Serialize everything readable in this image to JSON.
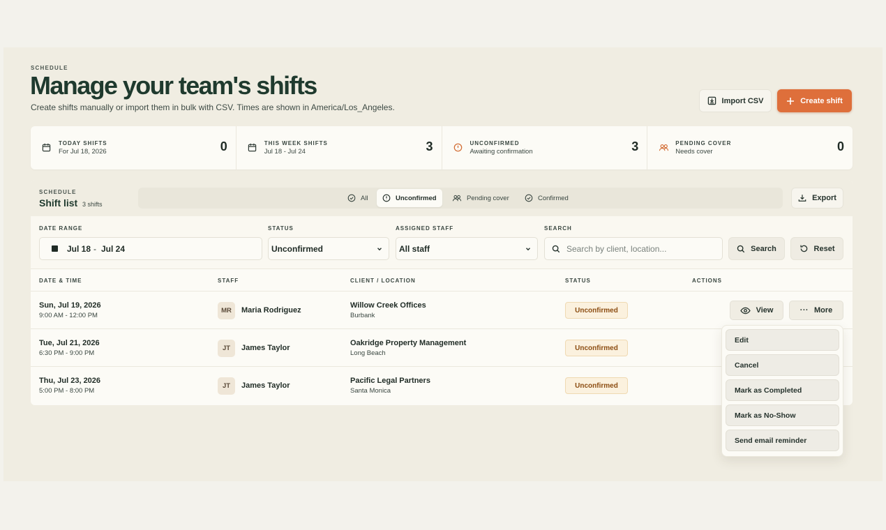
{
  "header": {
    "eyebrow": "SCHEDULE",
    "title": "Manage your team's shifts",
    "subtitle": "Create shifts manually or import them in bulk with CSV. Times are shown in America/Los_Angeles.",
    "import_label": "Import CSV",
    "create_label": "Create shift"
  },
  "stats": [
    {
      "label": "TODAY SHIFTS",
      "sub": "For Jul 18, 2026",
      "value": "0",
      "icon": "calendar-icon"
    },
    {
      "label": "THIS WEEK SHIFTS",
      "sub": "Jul 18 - Jul 24",
      "value": "3",
      "icon": "calendar-icon"
    },
    {
      "label": "UNCONFIRMED",
      "sub": "Awaiting confirmation",
      "value": "3",
      "icon": "alert-circle-icon"
    },
    {
      "label": "PENDING COVER",
      "sub": "Needs cover",
      "value": "0",
      "icon": "users-icon"
    }
  ],
  "list": {
    "eyebrow": "SCHEDULE",
    "title": "Shift list",
    "count": "3 shifts",
    "tabs": [
      {
        "label": "All",
        "active": false
      },
      {
        "label": "Unconfirmed",
        "active": true
      },
      {
        "label": "Pending cover",
        "active": false
      },
      {
        "label": "Confirmed",
        "active": false
      }
    ],
    "export_label": "Export"
  },
  "filters": {
    "date_range_label": "DATE RANGE",
    "date_from": "Jul 18",
    "date_sep": "-",
    "date_to": "Jul 24",
    "status_label": "STATUS",
    "status_value": "Unconfirmed",
    "staff_label": "ASSIGNED STAFF",
    "staff_value": "All staff",
    "search_label": "SEARCH",
    "search_placeholder": "Search by client, location...",
    "search_button": "Search",
    "reset_button": "Reset"
  },
  "table": {
    "columns": [
      "DATE & TIME",
      "STAFF",
      "CLIENT / LOCATION",
      "STATUS",
      "ACTIONS"
    ],
    "rows": [
      {
        "date": "Sun, Jul 19, 2026",
        "time": "9:00 AM - 12:00 PM",
        "initials": "MR",
        "staff": "Maria Rodriguez",
        "client": "Willow Creek Offices",
        "location": "Burbank",
        "status": "Unconfirmed"
      },
      {
        "date": "Tue, Jul 21, 2026",
        "time": "6:30 PM - 9:00 PM",
        "initials": "JT",
        "staff": "James Taylor",
        "client": "Oakridge Property Management",
        "location": "Long Beach",
        "status": "Unconfirmed"
      },
      {
        "date": "Thu, Jul 23, 2026",
        "time": "5:00 PM - 8:00 PM",
        "initials": "JT",
        "staff": "James Taylor",
        "client": "Pacific Legal Partners",
        "location": "Santa Monica",
        "status": "Unconfirmed"
      }
    ],
    "view_label": "View",
    "more_dots": "...",
    "more_label": "More"
  },
  "menu": {
    "items": [
      "Edit",
      "Cancel",
      "Mark as Completed",
      "Mark as No-Show",
      "Send email reminder"
    ]
  },
  "colors": {
    "accent": "#de6f3b",
    "title_green": "#1f3a2e",
    "badge_bg": "#fbf1de",
    "badge_text": "#8c4d12",
    "background": "#f3f2ec"
  }
}
